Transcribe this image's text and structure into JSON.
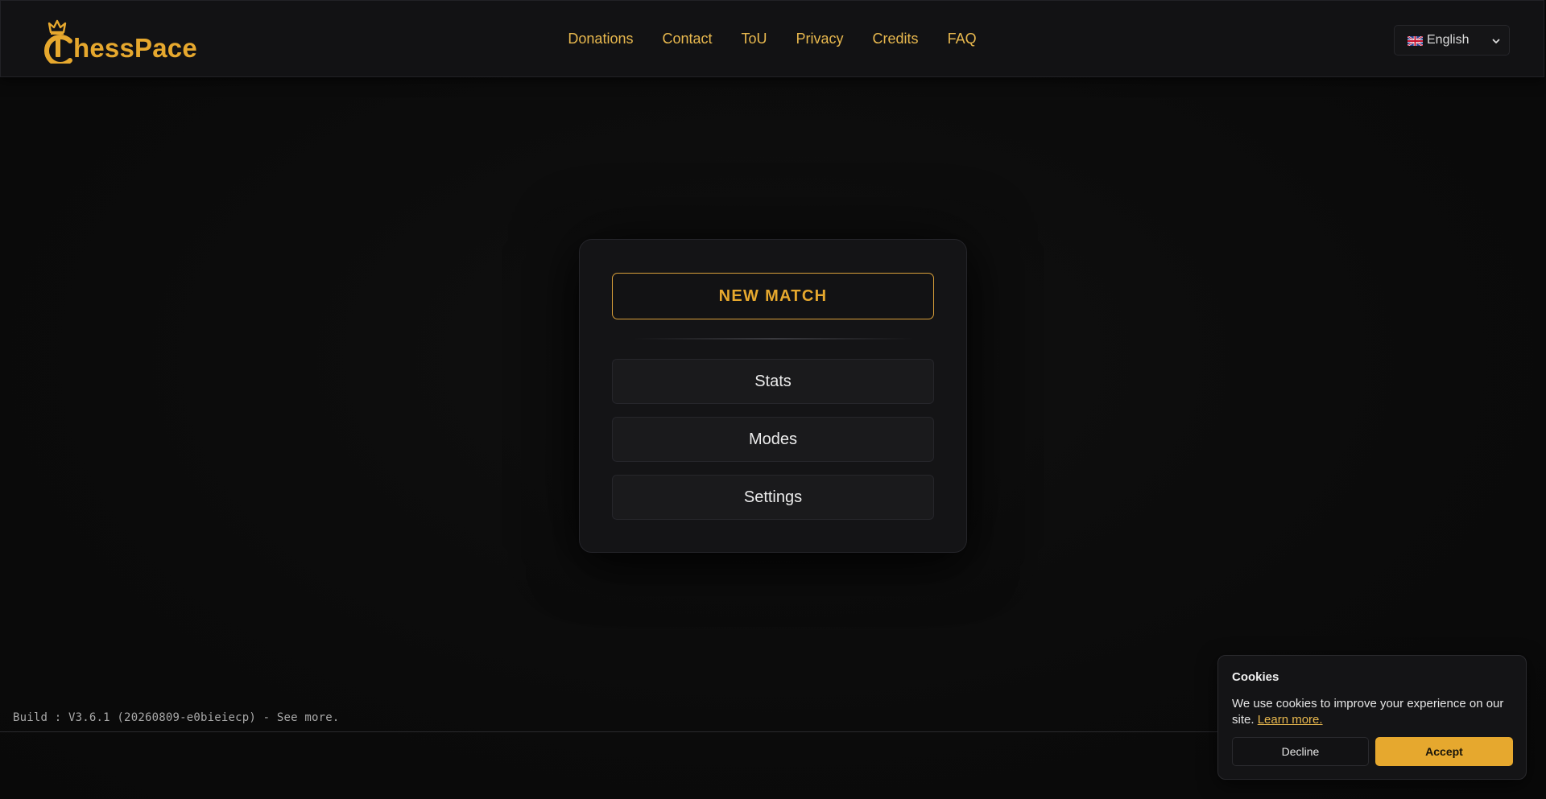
{
  "brand": {
    "name_rest": "hessPace",
    "logo_icon": "crowned-c-logo-icon",
    "accent_color": "#e6a82e"
  },
  "nav": {
    "items": [
      {
        "label": "Donations"
      },
      {
        "label": "Contact"
      },
      {
        "label": "ToU"
      },
      {
        "label": "Privacy"
      },
      {
        "label": "Credits"
      },
      {
        "label": "FAQ"
      }
    ]
  },
  "language": {
    "selected": "English",
    "flag_icon": "uk-flag-icon"
  },
  "menu": {
    "new_match": "NEW MATCH",
    "items": [
      {
        "label": "Stats"
      },
      {
        "label": "Modes"
      },
      {
        "label": "Settings"
      }
    ]
  },
  "build": {
    "text": "Build : V3.6.1 (20260809-e0bieiecp) - See more."
  },
  "cookie": {
    "title": "Cookies",
    "text": "We use cookies to improve your experience on our site.",
    "link": "Learn more.",
    "decline": "Decline",
    "accept": "Accept"
  }
}
